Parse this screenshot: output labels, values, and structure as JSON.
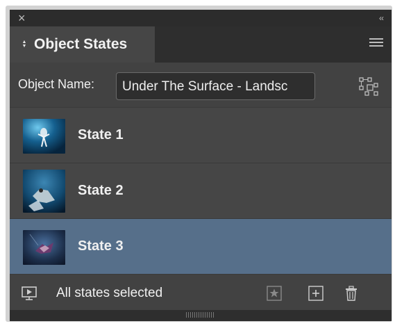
{
  "panel": {
    "title": "Object States",
    "close_glyph": "×",
    "collapse_glyph": "‹‹"
  },
  "object_name": {
    "label": "Object Name:",
    "value": "Under The Surface - Landsc"
  },
  "states": [
    {
      "label": "State 1",
      "selected": false
    },
    {
      "label": "State 2",
      "selected": false
    },
    {
      "label": "State 3",
      "selected": true
    }
  ],
  "footer": {
    "status": "All states selected"
  },
  "colors": {
    "panel_bg": "#424242",
    "selected_row": "#566f8a",
    "text": "#f0f0f0"
  },
  "icons": {
    "header_menu": "hamburger-menu-icon",
    "convert": "convert-to-multistate-icon",
    "preview": "preview-icon",
    "new_state_from_selection": "star-icon",
    "new_state": "plus-icon",
    "delete": "trash-icon"
  }
}
